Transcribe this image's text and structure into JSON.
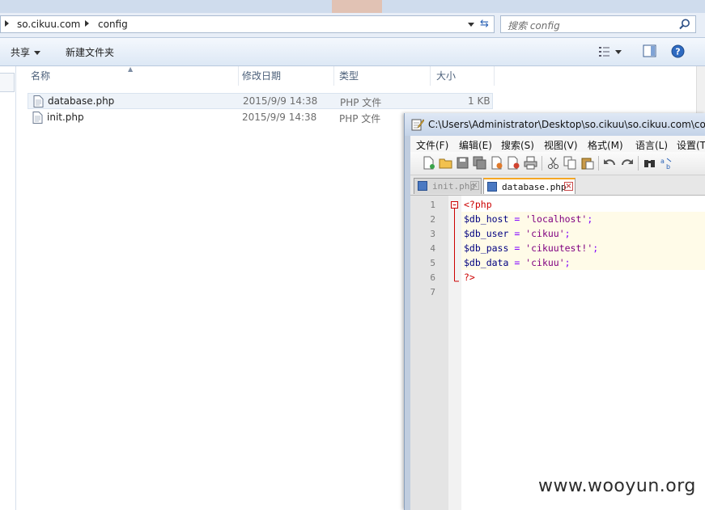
{
  "explorer": {
    "breadcrumbs": [
      "so.cikuu.com",
      "config"
    ],
    "search_placeholder": "搜索 config",
    "toolbar": {
      "share_label": "共享",
      "new_folder_label": "新建文件夹"
    },
    "columns": {
      "name": "名称",
      "modified": "修改日期",
      "type": "类型",
      "size": "大小"
    },
    "files": [
      {
        "name": "database.php",
        "modified": "2015/9/9 14:38",
        "type": "PHP 文件",
        "size": "1 KB"
      },
      {
        "name": "init.php",
        "modified": "2015/9/9 14:38",
        "type": "PHP 文件",
        "size": ""
      }
    ]
  },
  "notepad": {
    "title": "C:\\Users\\Administrator\\Desktop\\so.cikuu\\so.cikuu.com\\con",
    "menu": [
      "文件(F)",
      "编辑(E)",
      "搜索(S)",
      "视图(V)",
      "格式(M)",
      "语言(L)",
      "设置(T"
    ],
    "tabs": [
      {
        "label": "init.php",
        "active": false
      },
      {
        "label": "database.php",
        "active": true
      }
    ],
    "line_numbers": [
      "1",
      "2",
      "3",
      "4",
      "5",
      "6",
      "7"
    ],
    "code": {
      "l1_tag": "<?php",
      "l2_var": "$db_host",
      "l2_op": " = ",
      "l2_str": "'localhost'",
      "l2_end": ";",
      "l3_var": "$db_user",
      "l3_op": " = ",
      "l3_str": "'cikuu'",
      "l3_end": ";",
      "l4_var": "$db_pass",
      "l4_op": " = ",
      "l4_str": "'cikuutest!'",
      "l4_end": ";",
      "l5_var": "$db_data",
      "l5_op": " = ",
      "l5_str": "'cikuu'",
      "l5_end": ";",
      "l6_tag": "?>"
    }
  },
  "watermark": "www.wooyun.org",
  "colors": {
    "php_tag": "#cc0000",
    "variable": "#000080",
    "operator": "#8000ff",
    "string": "#800080"
  }
}
